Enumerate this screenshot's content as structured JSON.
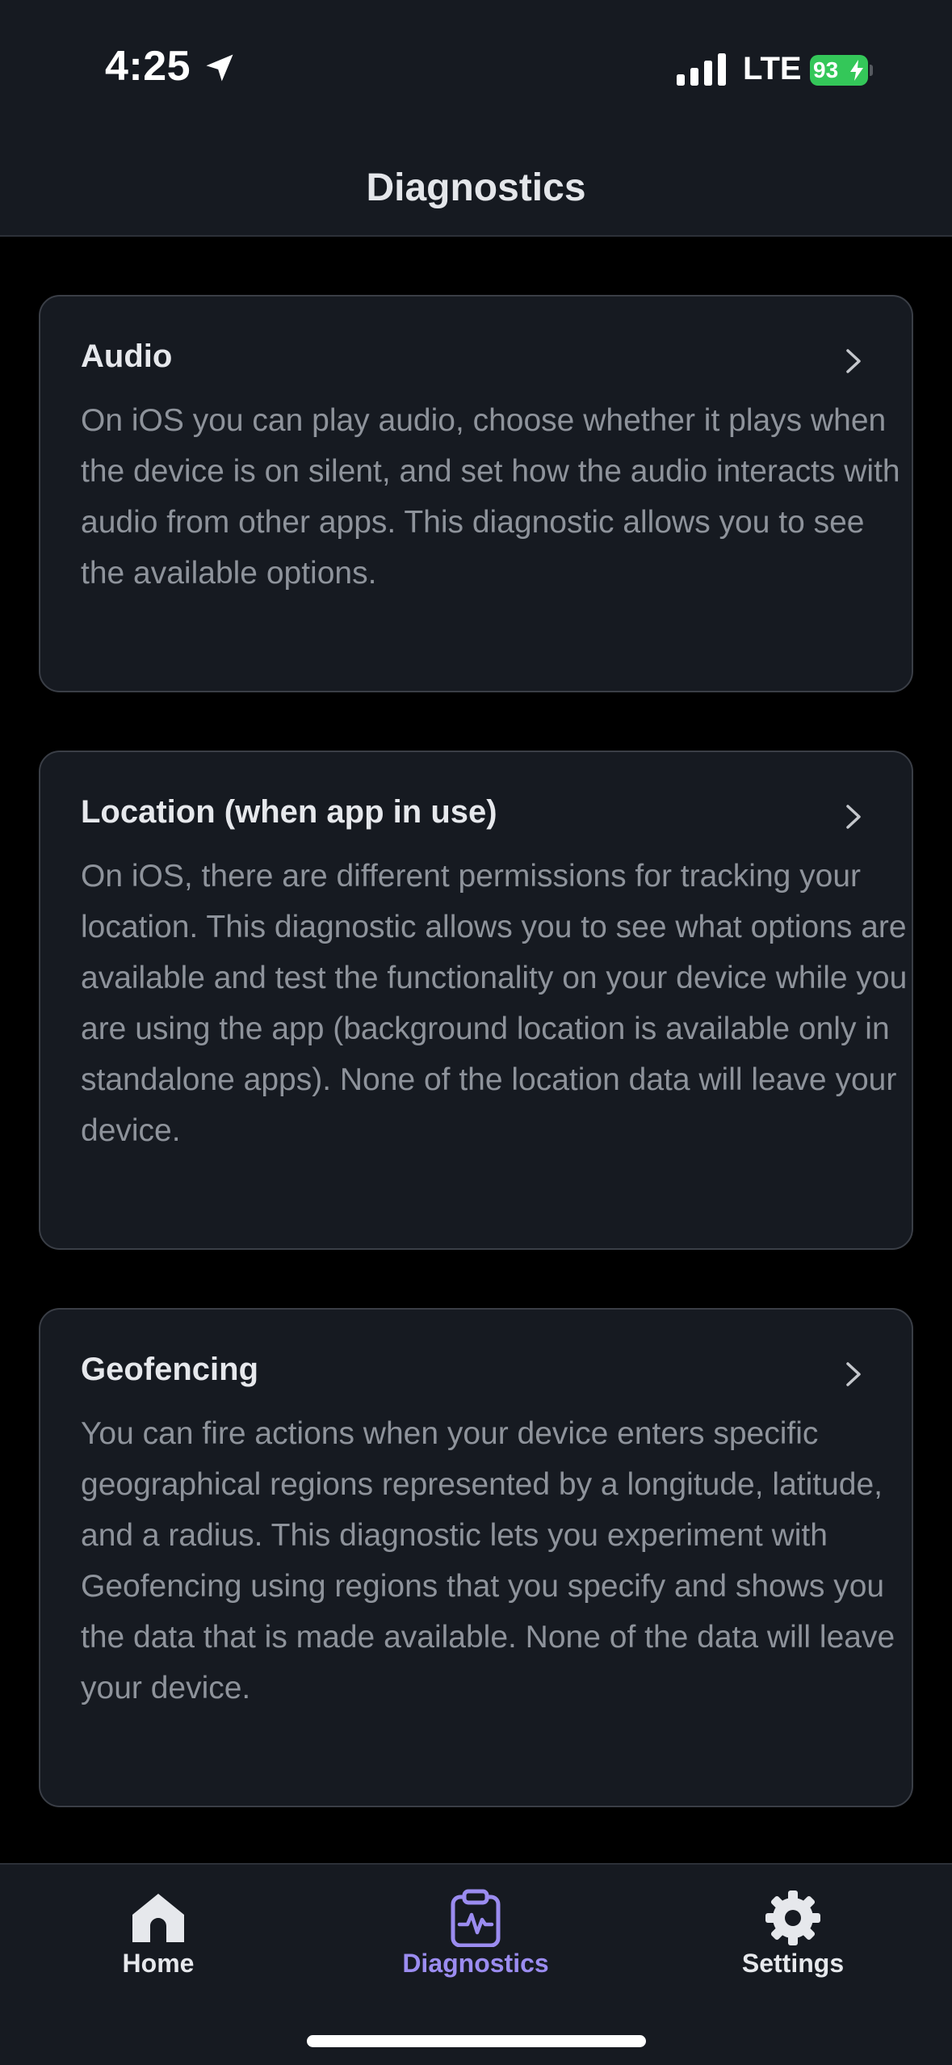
{
  "status_bar": {
    "time": "4:25",
    "network": "LTE",
    "battery": "93"
  },
  "header": {
    "title": "Diagnostics"
  },
  "cards": [
    {
      "title": "Audio",
      "description": "On iOS you can play audio, choose whether it plays when the device is on silent, and set how the audio interacts with audio from other apps. This diagnostic allows you to see the available options."
    },
    {
      "title": "Location (when app in use)",
      "description": "On iOS, there are different permissions for tracking your location. This diagnostic allows you to see what options are available and test the functionality on your device while you are using the app (background location is available only in standalone apps). None of the location data will leave your device."
    },
    {
      "title": "Geofencing",
      "description": "You can fire actions when your device enters specific geographical regions represented by a longitude, latitude, and a radius. This diagnostic lets you experiment with Geofencing using regions that you specify and shows you the data that is made available. None of the data will leave your device."
    }
  ],
  "tabbar": {
    "tabs": [
      {
        "label": "Home",
        "icon": "home-icon",
        "active": false
      },
      {
        "label": "Diagnostics",
        "icon": "clipboard-pulse-icon",
        "active": true
      },
      {
        "label": "Settings",
        "icon": "gear-icon",
        "active": false
      }
    ],
    "active_color": "#9b8cf0",
    "inactive_color": "#e6e8ec"
  },
  "colors": {
    "background": "#000000",
    "surface": "#161a21",
    "card_border": "#3a3e46",
    "battery": "#34c759",
    "muted_text": "#8e939b"
  }
}
